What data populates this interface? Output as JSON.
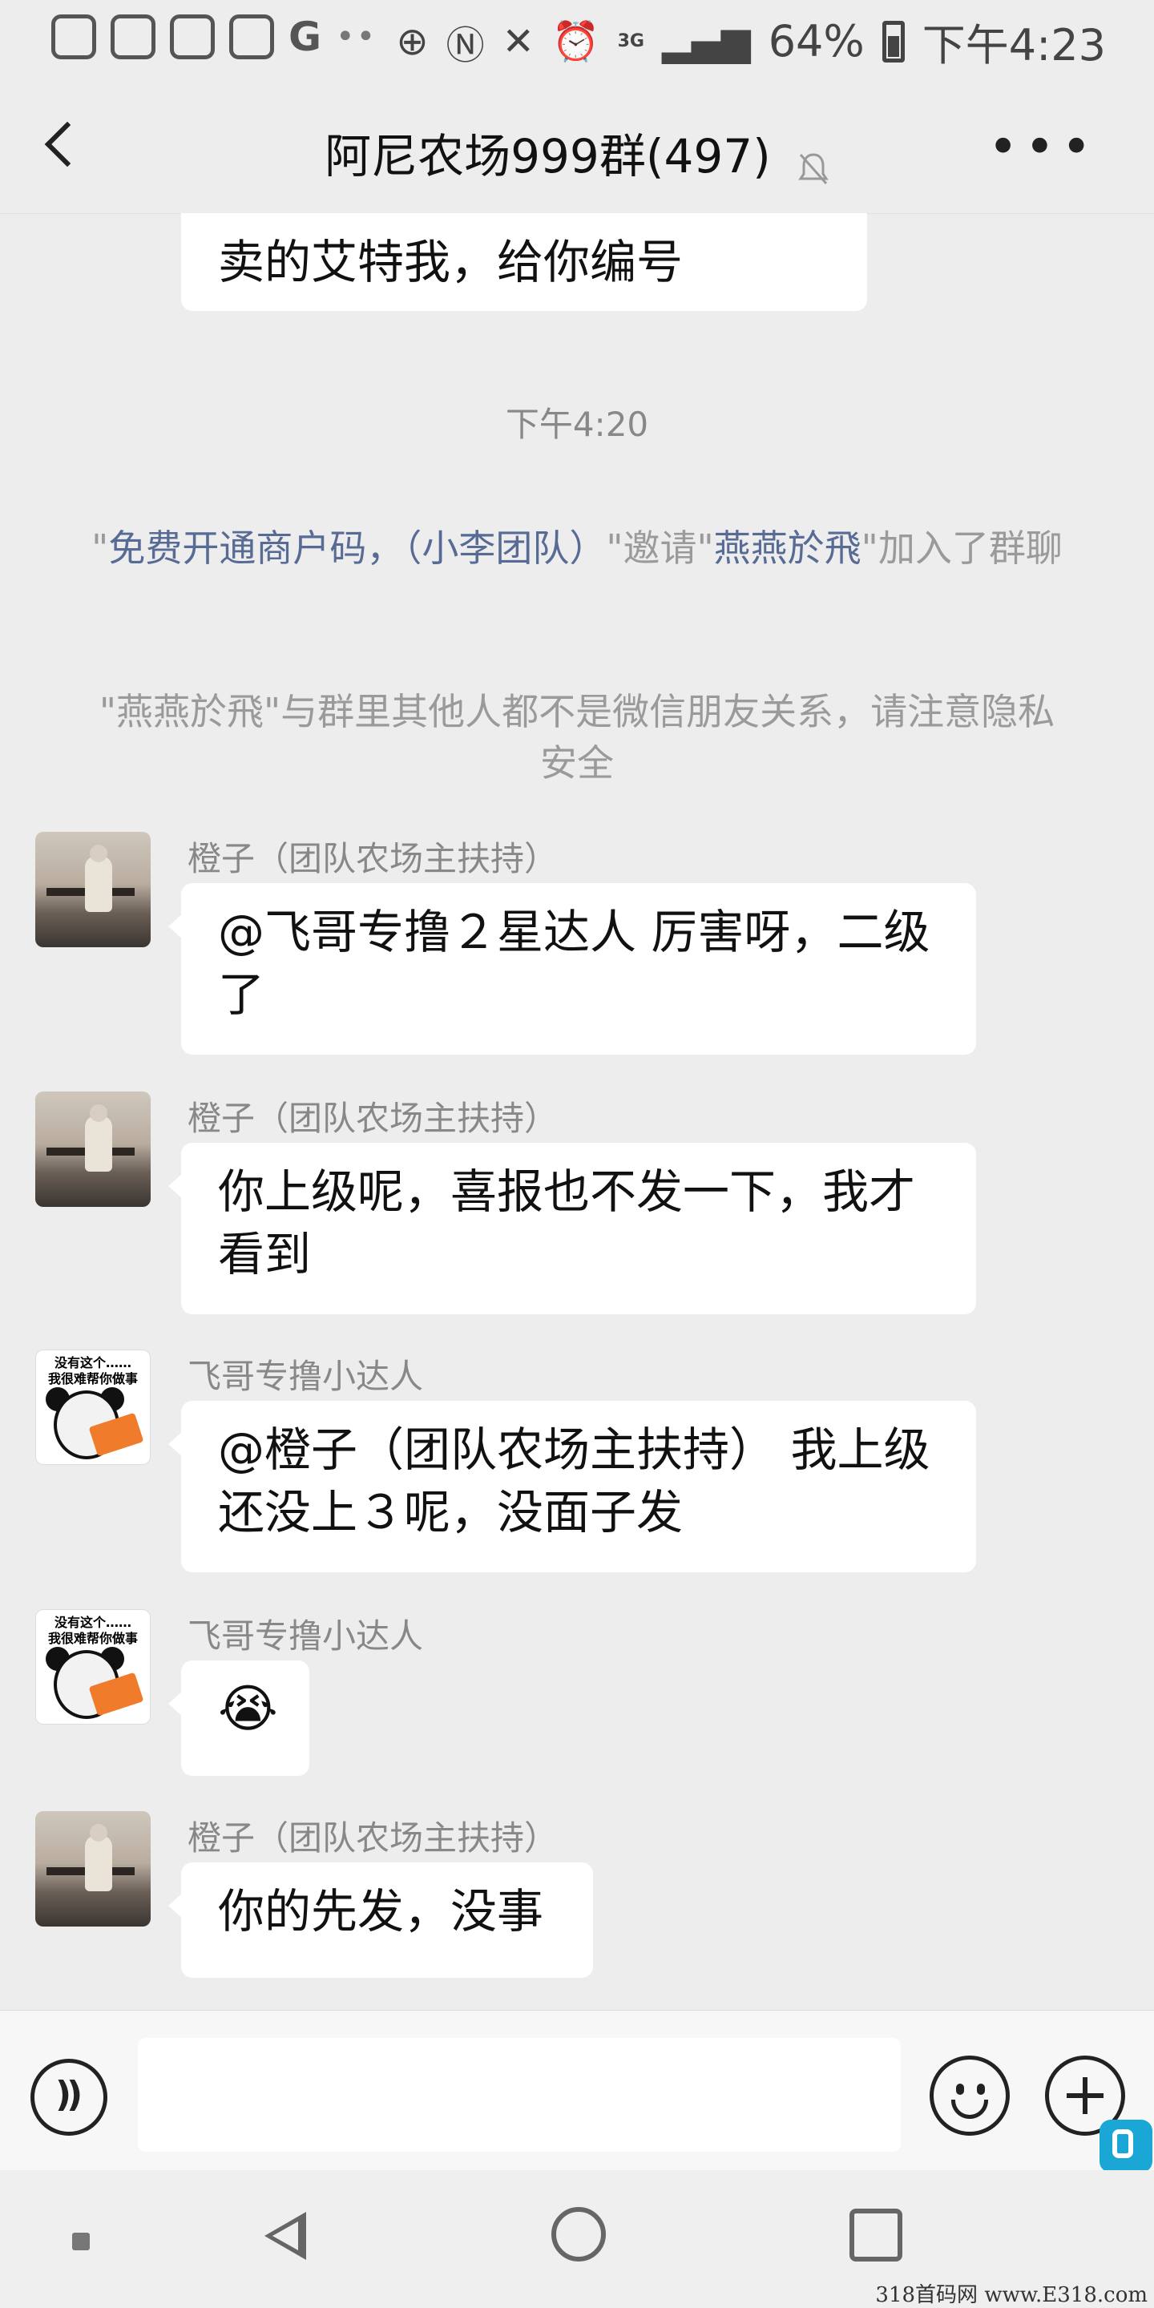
{
  "status_bar": {
    "battery": "64%",
    "time": "下午4:23",
    "network": "3G"
  },
  "header": {
    "title": "阿尼农场999群(497)"
  },
  "messages": {
    "top_bubble": "卖的艾特我，给你编号",
    "timestamp": "下午4:20",
    "system1": {
      "q1": "\"",
      "name1": "免费开通商户码，（小李团队）",
      "mid": "\"邀请\"",
      "name2": "燕燕於飛",
      "tail": "\"加入了群聊"
    },
    "system2": "\"燕燕於飛\"与群里其他人都不是微信朋友关系，请注意隐私安全",
    "m1": {
      "sender": "橙子（团队农场主扶持）",
      "text": "@飞哥专撸２星达人  厉害呀，二级了"
    },
    "m2": {
      "sender": "橙子（团队农场主扶持）",
      "text": "你上级呢，喜报也不发一下，我才看到"
    },
    "m3": {
      "sender": "飞哥专撸小达人",
      "text": "@橙子（团队农场主扶持）  我上级还没上３呢，没面子发"
    },
    "m4": {
      "sender": "飞哥专撸小达人",
      "text": "😭"
    },
    "m5": {
      "sender": "橙子（团队农场主扶持）",
      "text": "你的先发，没事"
    },
    "panda_avatar_text": "没有这个……\n我很难帮你做事"
  },
  "input": {
    "placeholder": ""
  },
  "watermark": "318首码网  www.E318.com"
}
